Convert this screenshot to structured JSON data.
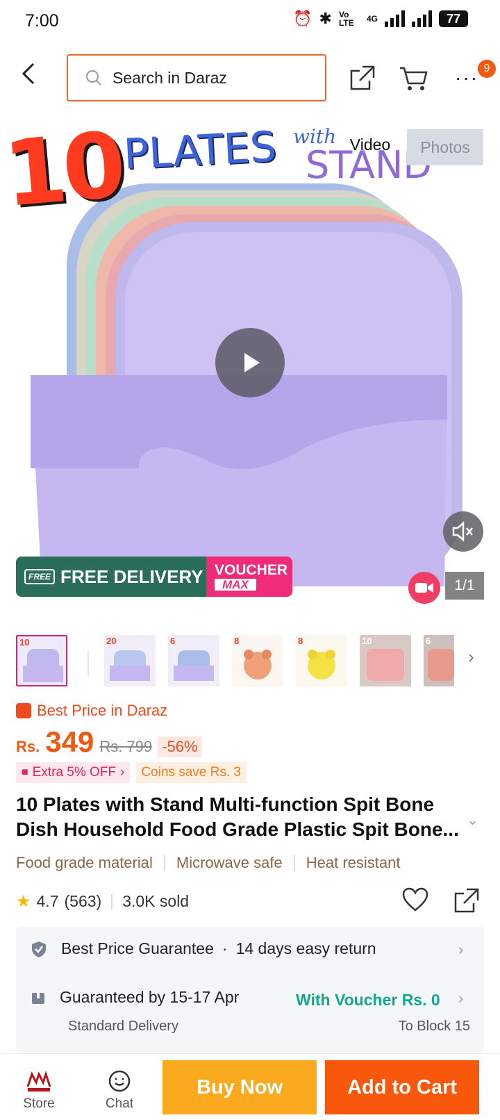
{
  "status_bar": {
    "time": "7:00",
    "network": "Vo LTE",
    "net_type": "4G",
    "battery": "77"
  },
  "search": {
    "placeholder": "Search in Daraz"
  },
  "header": {
    "more_badge": "9"
  },
  "hero": {
    "image_text": {
      "number": "10",
      "plates": "PLATES",
      "with": "with",
      "stand": "STAND"
    },
    "media_tabs": {
      "video": "Video",
      "photos": "Photos"
    },
    "free_delivery": "FREE DELIVERY",
    "free_tag": "FREE",
    "voucher_1": "VOUCHER",
    "voucher_2": "MAX",
    "counter": "1/1"
  },
  "thumbnails": [
    {
      "id": "t1",
      "selected": true,
      "label": "10"
    },
    {
      "id": "t2",
      "selected": false,
      "label": "20"
    },
    {
      "id": "t3",
      "selected": false,
      "label": "6"
    },
    {
      "id": "t4",
      "selected": false,
      "label": "8"
    },
    {
      "id": "t5",
      "selected": false,
      "label": "8"
    },
    {
      "id": "t6",
      "selected": false,
      "label": "10"
    },
    {
      "id": "t7",
      "selected": false,
      "label": "6"
    }
  ],
  "product": {
    "best_price_label": "Best Price in Daraz",
    "currency": "Rs.",
    "price": "349",
    "original_price": "Rs. 799",
    "discount": "-56%",
    "extra_off": "Extra 5% OFF",
    "coins": "Coins save Rs. 3",
    "title": "10 Plates with Stand Multi-function Spit Bone Dish Household Food Grade Plastic Spit Bone...",
    "features": [
      "Food grade material",
      "Microwave safe",
      "Heat resistant"
    ],
    "rating": "4.7",
    "reviews": "(563)",
    "sold": "3.0K sold"
  },
  "info": {
    "guarantee": "Best Price Guarantee",
    "dot": "·",
    "returns": "14 days easy return",
    "delivery": "Guaranteed by 15-17 Apr",
    "voucher": "With Voucher Rs. 0",
    "delivery_type": "Standard Delivery",
    "location": "To Block 15"
  },
  "bottom": {
    "store": "Store",
    "chat": "Chat",
    "buy_now": "Buy Now",
    "add_to_cart": "Add to Cart"
  },
  "colors": {
    "accent": "#f9570c",
    "buy": "#fba91f",
    "green": "#12a88b",
    "delivery": "#2a6d58"
  }
}
